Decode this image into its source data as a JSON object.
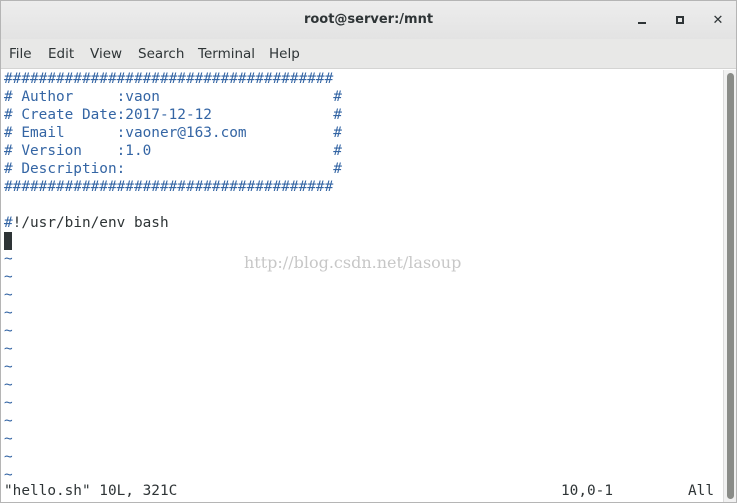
{
  "window": {
    "title": "root@server:/mnt"
  },
  "menu": {
    "items": [
      "File",
      "Edit",
      "View",
      "Search",
      "Terminal",
      "Help"
    ]
  },
  "editor": {
    "lines": [
      "######################################",
      "# Author     :vaon                    #",
      "# Create Date:2017-12-12              #",
      "# Email      :vaoner@163.com          #",
      "# Version    :1.0                     #",
      "# Description:                        #",
      "######################################",
      ""
    ],
    "shebang_hash": "#",
    "shebang_rest": "!/usr/bin/env bash",
    "tilde": "~",
    "tilde_count": 13,
    "watermark": "http://blog.csdn.net/lasoup"
  },
  "status": {
    "file_info": "\"hello.sh\" 10L, 321C",
    "position": "10,0-1",
    "scroll": "All"
  },
  "colors": {
    "comment": "#3465a4",
    "text": "#2e3436"
  },
  "icons": {
    "minimize": "minimize-icon",
    "maximize": "maximize-icon",
    "close": "close-icon"
  }
}
